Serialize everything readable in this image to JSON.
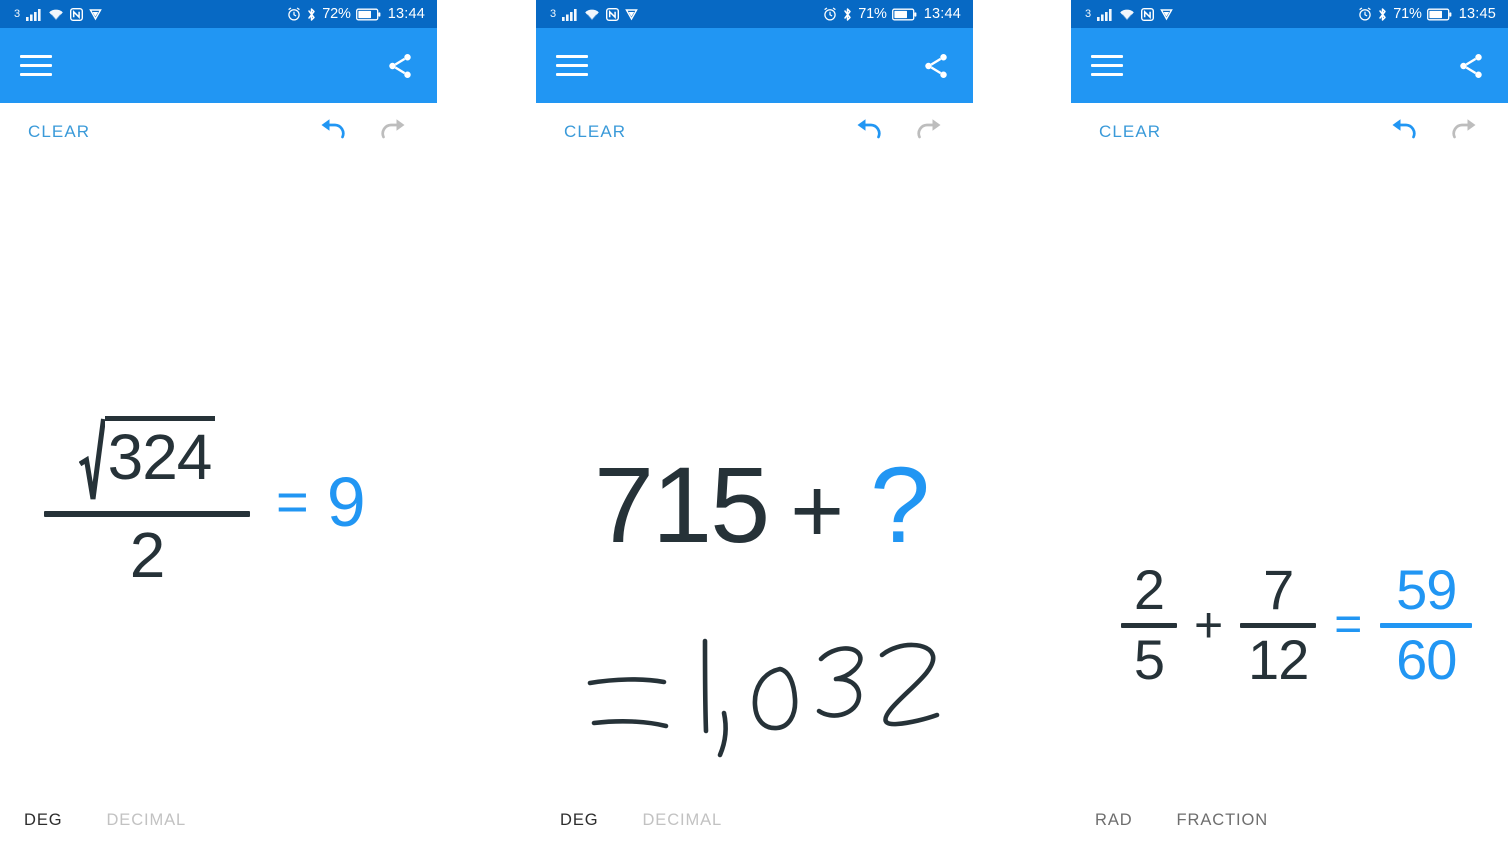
{
  "app": {
    "accent_blue": "#2196f3",
    "statusbar_blue": "#0769c4",
    "ink_dark": "#263238",
    "clear_label": "CLEAR",
    "menu_icon": "hamburger-menu-icon",
    "share_icon": "share-icon",
    "undo_icon": "undo-icon",
    "redo_icon": "redo-icon"
  },
  "screens": [
    {
      "id": "screen-1",
      "statusbar": {
        "network": "3",
        "signal_icon": "signal-bars-icon",
        "wifi_icon": "wifi-icon",
        "nfc_icon": "nfc-icon",
        "cast_icon": "cast-play-icon",
        "alarm_icon": "alarm-clock-icon",
        "bluetooth_icon": "bluetooth-icon",
        "battery_percent": "72%",
        "battery_icon": "battery-icon",
        "time": "13:44"
      },
      "expression": {
        "kind": "sqrt-over-fraction",
        "radicand": "324",
        "denominator": "2",
        "equals": "=",
        "result": "9"
      },
      "modes": [
        {
          "label": "DEG",
          "state": "active"
        },
        {
          "label": "DECIMAL",
          "state": "dim"
        }
      ]
    },
    {
      "id": "screen-2",
      "statusbar": {
        "network": "3",
        "signal_icon": "signal-bars-icon",
        "wifi_icon": "wifi-icon",
        "nfc_icon": "nfc-icon",
        "cast_icon": "cast-play-icon",
        "alarm_icon": "alarm-clock-icon",
        "bluetooth_icon": "bluetooth-icon",
        "battery_percent": "71%",
        "battery_icon": "battery-icon",
        "time": "13:44"
      },
      "expression": {
        "kind": "addition-with-unknown",
        "operand": "715",
        "operator": "+",
        "unknown": "?",
        "handwriting": "=1,032"
      },
      "modes": [
        {
          "label": "DEG",
          "state": "active"
        },
        {
          "label": "DECIMAL",
          "state": "dim"
        }
      ]
    },
    {
      "id": "screen-3",
      "statusbar": {
        "network": "3",
        "signal_icon": "signal-bars-icon",
        "wifi_icon": "wifi-icon",
        "nfc_icon": "nfc-icon",
        "cast_icon": "cast-play-icon",
        "alarm_icon": "alarm-clock-icon",
        "bluetooth_icon": "bluetooth-icon",
        "battery_percent": "71%",
        "battery_icon": "battery-icon",
        "time": "13:45"
      },
      "expression": {
        "kind": "fraction-addition",
        "f1_num": "2",
        "f1_den": "5",
        "operator": "+",
        "f2_num": "7",
        "f2_den": "12",
        "equals": "=",
        "r_num": "59",
        "r_den": "60"
      },
      "modes": [
        {
          "label": "RAD",
          "state": "mid"
        },
        {
          "label": "FRACTION",
          "state": "mid"
        }
      ]
    }
  ]
}
